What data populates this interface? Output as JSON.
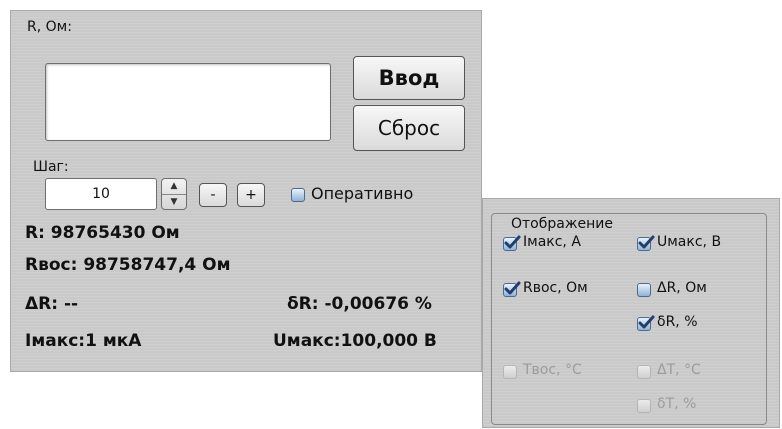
{
  "main": {
    "resistance_label": "R, Ом:",
    "resistance_value": "",
    "enter_button": "Ввод",
    "reset_button": "Сброс",
    "step_label": "Шаг:",
    "step_value": "10",
    "minus_label": "-",
    "plus_label": "+",
    "operative_label": "Оперативно",
    "operative_checked": false
  },
  "readings": {
    "r": "R: 98765430 Ом",
    "rvos": "Rвос: 98758747,4 Ом",
    "delta_r": "ΔR: --",
    "delta_r_rel": "δR: -0,00676 %",
    "imax": "Iмакс:1 мкА",
    "umax": "Uмакс:100,000 В"
  },
  "display": {
    "title": "Отображение",
    "options": [
      {
        "label": "Iмакс, А",
        "checked": true,
        "enabled": true
      },
      {
        "label": "Uмакс, В",
        "checked": true,
        "enabled": true
      },
      {
        "label": "Rвос, Ом",
        "checked": true,
        "enabled": true
      },
      {
        "label": "ΔR, Ом",
        "checked": false,
        "enabled": true
      },
      {
        "label": "δR, %",
        "checked": true,
        "enabled": true
      },
      {
        "label": "Tвос, °С",
        "checked": false,
        "enabled": false
      },
      {
        "label": "ΔT, °С",
        "checked": false,
        "enabled": false
      },
      {
        "label": "δT, %",
        "checked": false,
        "enabled": false
      }
    ]
  },
  "colors": {
    "checkbox_border": "#4d6b8c",
    "disabled_text": "#9c9c9c"
  }
}
